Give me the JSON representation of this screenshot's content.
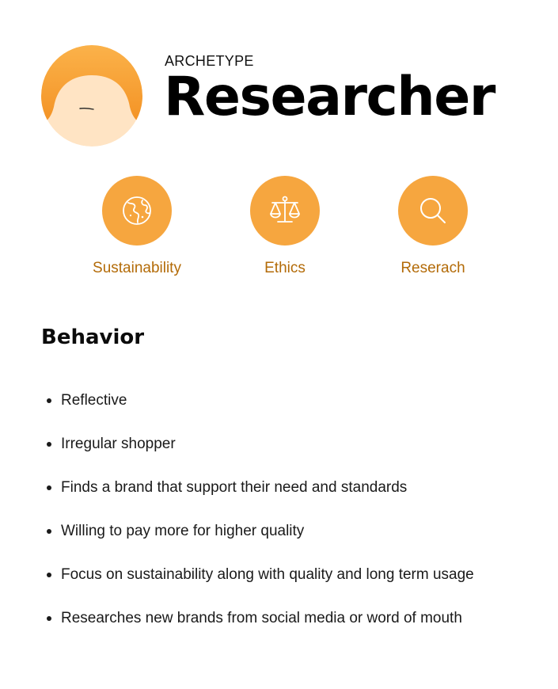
{
  "header": {
    "kicker": "ARCHETYPE",
    "title": "Researcher",
    "avatar_icon": "person-avatar-icon"
  },
  "traits": [
    {
      "label": "Sustainability",
      "icon": "globe-icon"
    },
    {
      "label": "Ethics",
      "icon": "scales-icon"
    },
    {
      "label": "Reserach",
      "icon": "search-icon"
    }
  ],
  "behavior": {
    "title": "Behavior",
    "items": [
      "Reflective",
      "Irregular shopper",
      "Finds a brand that support their need and standards",
      "Willing to pay more for higher quality",
      "Focus on sustainability along with quality and long term usage",
      "Researches new brands from social media or word of mouth"
    ]
  },
  "colors": {
    "accent": "#f6a63f",
    "accent_text": "#b36b08",
    "hair_light": "#fbb24a",
    "hair_dark": "#f39224",
    "skin": "#ffe4c4"
  }
}
